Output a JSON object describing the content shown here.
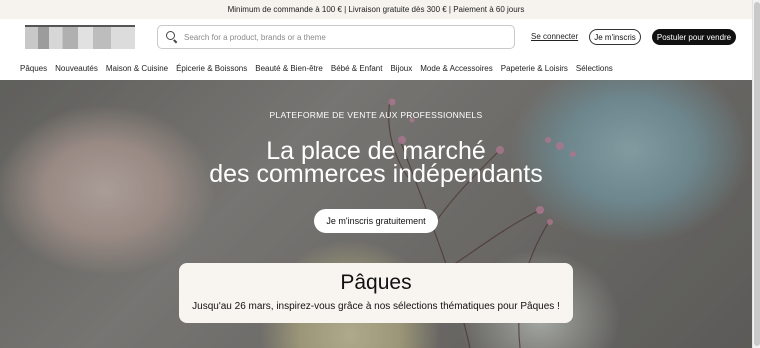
{
  "promo_bar": {
    "text": "Minimum de commande à 100 € | Livraison gratuite dès 300 € | Paiement à 60 jours"
  },
  "header": {
    "search_placeholder": "Search for a product, brands or a theme",
    "login_label": "Se connecter",
    "signup_label": "Je m'inscris",
    "sell_label": "Postuler pour vendre"
  },
  "nav": {
    "items": [
      "Pâques",
      "Nouveautés",
      "Maison & Cuisine",
      "Épicerie & Boissons",
      "Beauté & Bien-être",
      "Bébé & Enfant",
      "Bijoux",
      "Mode & Accessoires",
      "Papeterie & Loisirs",
      "Sélections"
    ]
  },
  "hero": {
    "kicker": "PLATEFORME DE VENTE AUX PROFESSIONNELS",
    "title_line1": "La place de marché",
    "title_line2": "des commerces indépendants",
    "cta_label": "Je m'inscris gratuitement"
  },
  "promo_card": {
    "title": "Pâques",
    "text": "Jusqu'au 26 mars, inspirez-vous grâce à nos sélections thématiques pour Pâques !"
  },
  "colors": {
    "brand_dark": "#111111",
    "promo_bg": "#f6f3ee",
    "card_bg": "#f8f5f0"
  }
}
